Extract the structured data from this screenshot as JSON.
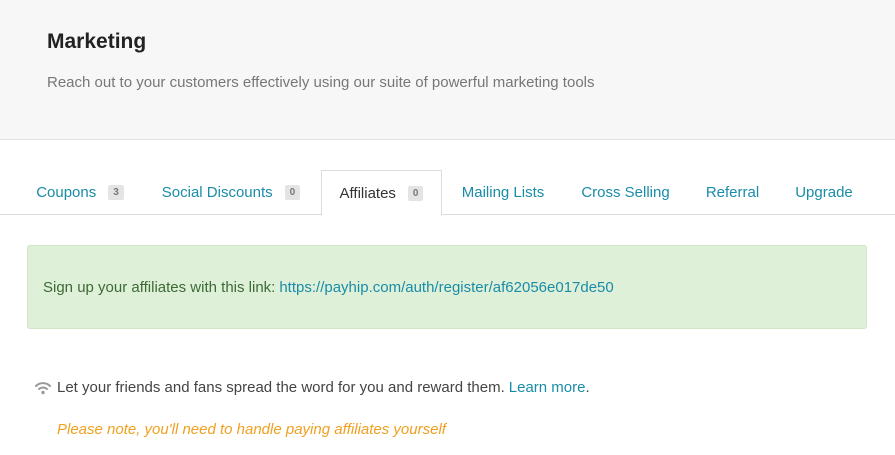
{
  "header": {
    "title": "Marketing",
    "subtitle": "Reach out to your customers effectively using our suite of powerful marketing tools"
  },
  "tabs": [
    {
      "label": "Coupons",
      "badge": "3"
    },
    {
      "label": "Social Discounts",
      "badge": "0"
    },
    {
      "label": "Affiliates",
      "badge": "0"
    },
    {
      "label": "Mailing Lists"
    },
    {
      "label": "Cross Selling"
    },
    {
      "label": "Referral"
    },
    {
      "label": "Upgrade"
    }
  ],
  "active_tab": "Affiliates",
  "alert": {
    "text": "Sign up your affiliates with this link:",
    "link": "https://payhip.com/auth/register/af62056e017de50"
  },
  "info": {
    "icon": "wifi-icon",
    "text": "Let your friends and fans spread the word for you and reward them.",
    "link": "Learn more",
    "suffix": "."
  },
  "note": "Please note, you'll need to handle paying affiliates yourself",
  "colors": {
    "link": "#1a8ca8",
    "alert_bg": "#dff0d8",
    "note": "#f0a020"
  }
}
